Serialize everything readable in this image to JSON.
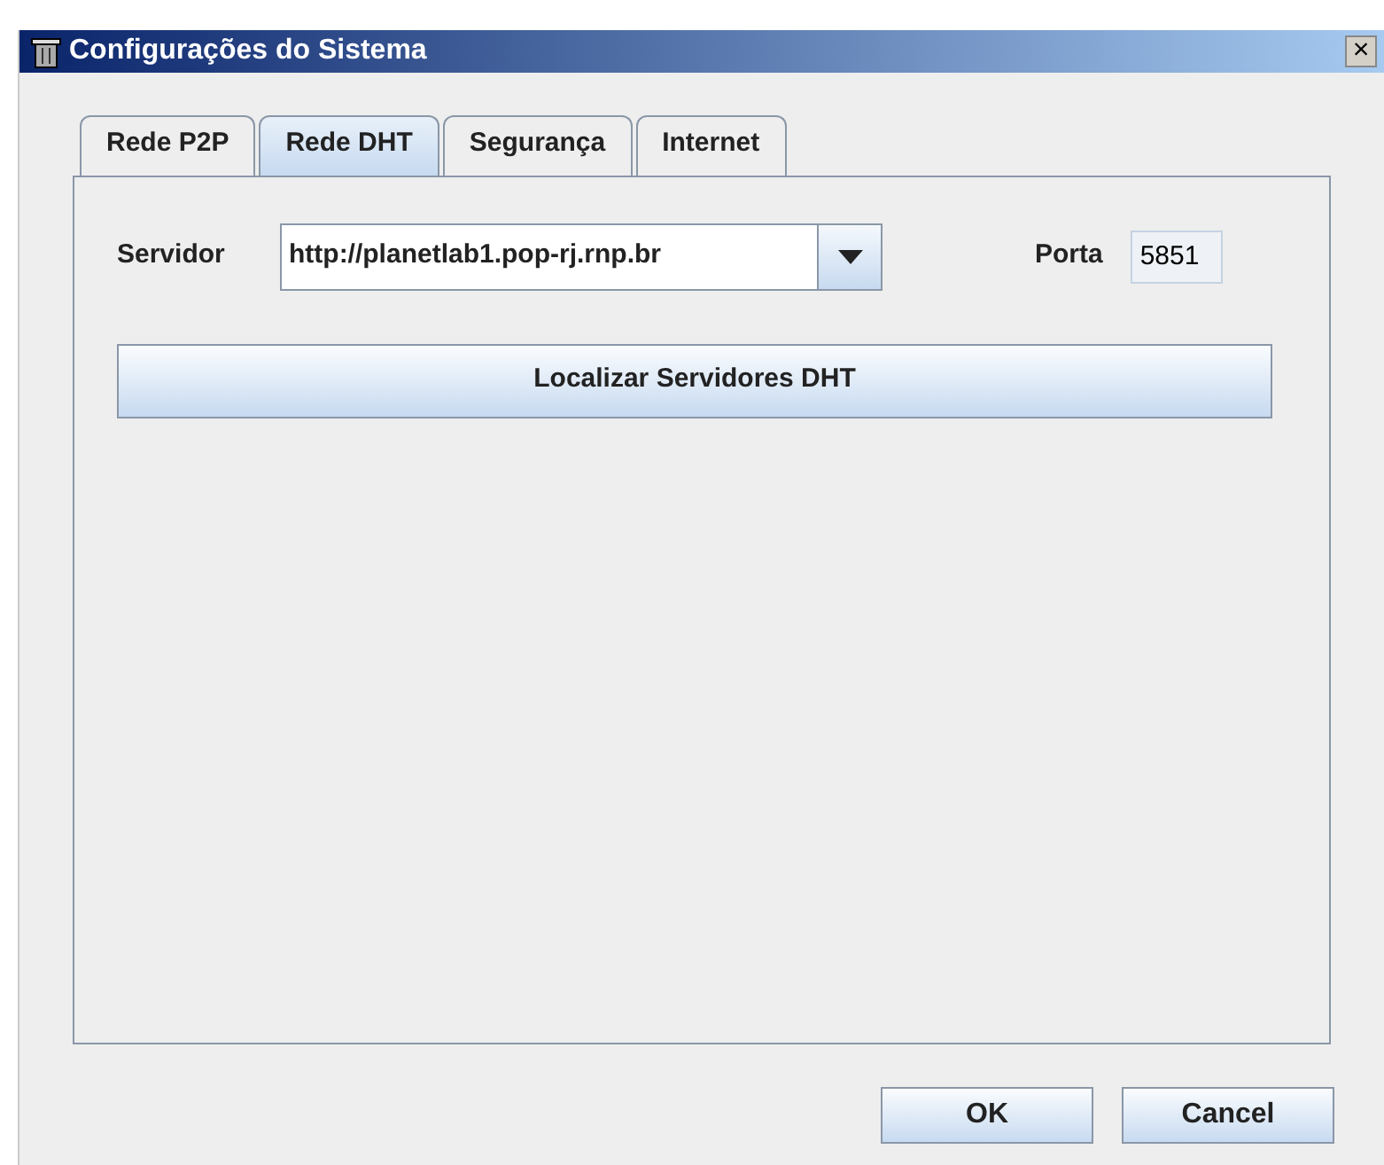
{
  "window": {
    "title": "Configurações do Sistema",
    "close": "×"
  },
  "tabs": [
    {
      "label": "Rede P2P",
      "selected": false
    },
    {
      "label": "Rede DHT",
      "selected": true
    },
    {
      "label": "Segurança",
      "selected": false
    },
    {
      "label": "Internet",
      "selected": false
    }
  ],
  "server": {
    "label": "Servidor",
    "value": "http://planetlab1.pop-rj.rnp.br"
  },
  "port": {
    "label": "Porta",
    "value": "5851"
  },
  "find_button": "Localizar Servidores DHT",
  "buttons": [
    "OK",
    "Cancel"
  ]
}
